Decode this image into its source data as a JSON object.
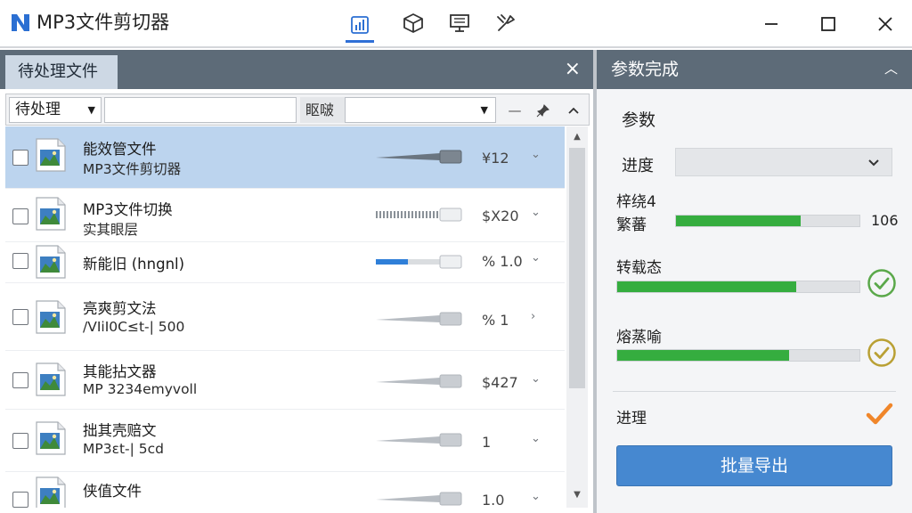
{
  "app": {
    "title": "MP3文件剪切器"
  },
  "toolbar": {
    "icons": [
      "chart-icon",
      "cube-icon",
      "monitor-icon",
      "tools-icon"
    ]
  },
  "left_panel": {
    "tab_label": "待处理文件",
    "close_glyph": "×",
    "filter": {
      "status_value": "待处理",
      "search_value": "",
      "sort_label": "眍啵",
      "sort_value": ""
    },
    "rows": [
      {
        "name_line1": "能效管文件",
        "name_line2": "MP3文件剪切器",
        "value": "¥12",
        "level": 0.95,
        "selected": true,
        "chevron": "⌄"
      },
      {
        "name_line1": "MP3文件切换",
        "name_line2": "实其眼层",
        "value": "$X20",
        "level": 0.95,
        "selected": false,
        "chevron": "⌄"
      },
      {
        "name_line1": "新能旧 (hngnl)",
        "name_line2": "",
        "value": "% 1.0",
        "level": 0.48,
        "selected": false,
        "chevron": "⌄"
      },
      {
        "name_line1": "亮爽剪文法",
        "name_line2": "/VIiI0C≤t-| 500",
        "value": "% 1",
        "level": 0.95,
        "selected": false,
        "chevron": "›"
      },
      {
        "name_line1": "其能拈文器",
        "name_line2": "MP 3234emyvoll",
        "value": "$427",
        "level": 0.95,
        "selected": false,
        "chevron": "⌄"
      },
      {
        "name_line1": "拙其壳赔文",
        "name_line2": "MP3εt-| 5cd",
        "value": "1",
        "level": 0.95,
        "selected": false,
        "chevron": "⌄"
      },
      {
        "name_line1": "侠值文件",
        "name_line2": "",
        "value": "1.0",
        "level": 0.95,
        "selected": false,
        "chevron": "⌄"
      }
    ]
  },
  "right_panel": {
    "title": "参数完成",
    "collapse_glyph": "︿",
    "section_title": "参数",
    "progress_label": "进度",
    "progress_value": "",
    "metric1_label_a": "梓绕4",
    "metric1_label_b": "繁蕃",
    "metric1_level": 0.68,
    "metric1_pct": "106",
    "metric2_label": "转载态",
    "metric2_level": 0.74,
    "metric3_label": "熔蒸喻",
    "metric3_level": 0.71,
    "process_label": "进理",
    "export_label": "批量导出"
  }
}
